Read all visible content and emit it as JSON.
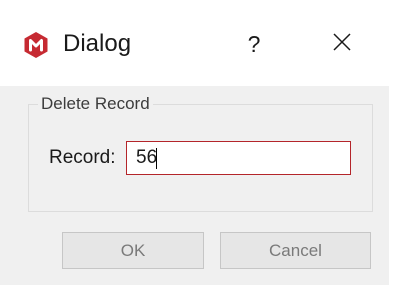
{
  "window": {
    "title": "Dialog",
    "help_label": "?",
    "app_icon": "app-logo-icon",
    "close_icon": "close-icon",
    "brand_color": "#c62a32"
  },
  "group": {
    "title": "Delete Record"
  },
  "form": {
    "record_label": "Record:",
    "record_value": "56",
    "input_border_color": "#b4252a"
  },
  "buttons": {
    "ok_label": "OK",
    "cancel_label": "Cancel"
  }
}
